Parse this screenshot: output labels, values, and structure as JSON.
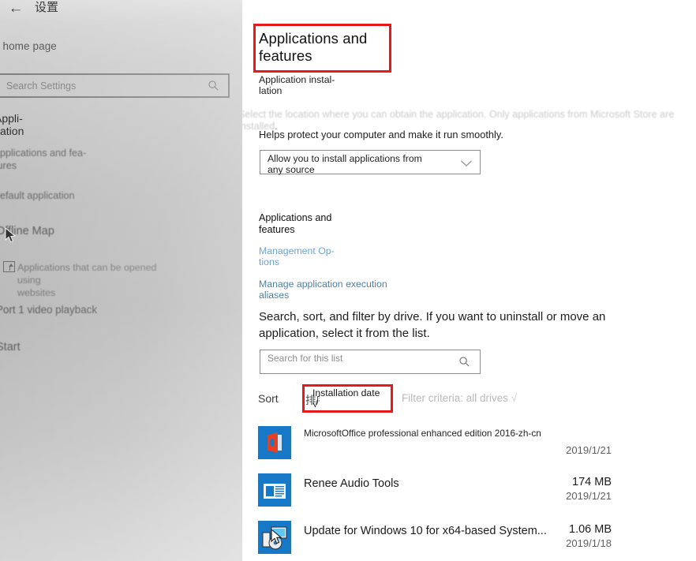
{
  "sidebar": {
    "back_icon": "back-arrow-icon",
    "title": "设置",
    "home_link": "n home page",
    "search": {
      "placeholder": "Search Settings",
      "icon": "search-icon"
    },
    "section_label": "Appli-\ncation",
    "items": [
      {
        "label": "applications and fea-\ntures",
        "icon": null
      },
      {
        "label": "default application",
        "icon": null
      },
      {
        "label": "Offline Map",
        "icon": null
      },
      {
        "label": "Applications that can be opened using\nwebsites",
        "icon": "open-with-website-icon"
      },
      {
        "label": "Port 1 video playback",
        "icon": null
      },
      {
        "label": "Start",
        "icon": null
      }
    ]
  },
  "main": {
    "heading": "Applications and\nfeatures",
    "subheading": "Application instal-\nlation",
    "faint_note": "Select the location where you can obtain the application. Only applications from Microsoft Store are installed",
    "helper_text": "Helps protect your computer and make it run smoothly.",
    "install_source_select": {
      "value": "Allow you to install applications from any source",
      "chevron_icon": "chevron-down-icon"
    },
    "section_heading": "Applications and\nfeatures",
    "links": [
      {
        "label": "Management Op-\ntions"
      },
      {
        "label": "Manage application execution\naliases"
      }
    ],
    "list_description": "Search, sort, and filter by drive. If you want to uninstall or move an application, select it from the list.",
    "list_search": {
      "placeholder": "Search for this list",
      "icon": "search-icon"
    },
    "sort": {
      "label": "Sort",
      "cjk_fragment": "排序:",
      "value": "Installation date √"
    },
    "filter": {
      "label": "Filter criteria: all drives",
      "check": "√"
    },
    "apps": [
      {
        "name": "MicrosoftOffice professional enhanced edition 2016-zh-cn",
        "size": "",
        "date": "2019/1/21",
        "icon": "office-app-icon"
      },
      {
        "name": "Renee Audio Tools",
        "size": "174 MB",
        "date": "2019/1/21",
        "icon": "renee-audio-tools-icon"
      },
      {
        "name": "Update for Windows 10 for x64-based System...",
        "size": "1.06 MB",
        "date": "2019/1/18",
        "icon": "windows-update-icon"
      }
    ]
  },
  "colors": {
    "highlight": "#e8191b",
    "link": "#6ba3d6",
    "icon_blue": "#1878c8",
    "office_orange": "#e8401f"
  }
}
